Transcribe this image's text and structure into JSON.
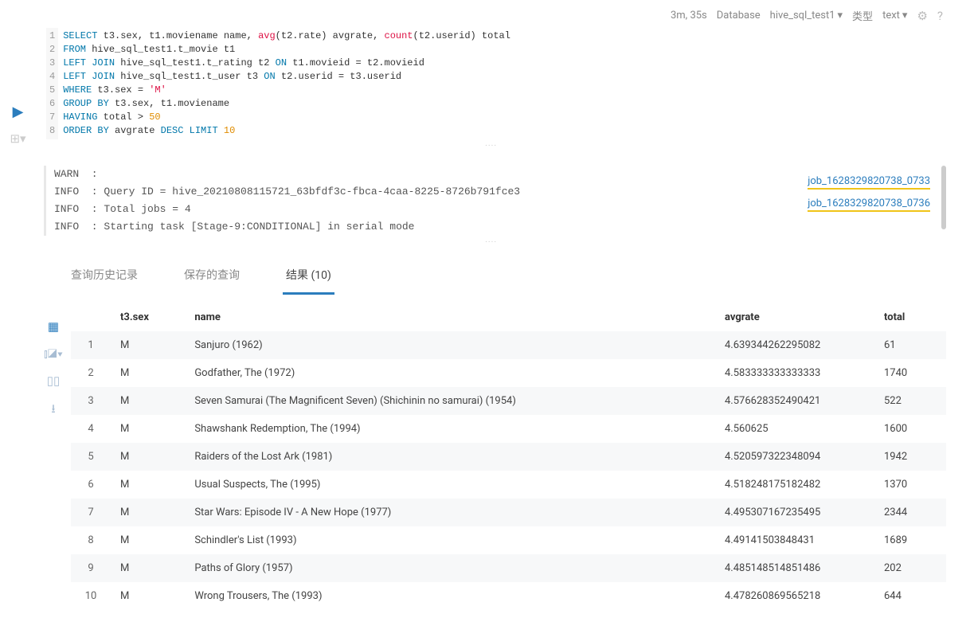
{
  "topbar": {
    "elapsed": "3m, 35s",
    "db_label": "Database",
    "db_value": "hive_sql_test1",
    "type_label": "类型",
    "type_value": "text"
  },
  "sql": {
    "lines": [
      "1",
      "2",
      "3",
      "4",
      "5",
      "6",
      "7",
      "8"
    ]
  },
  "log": {
    "l1": "WARN  :",
    "l2": "INFO  : Query ID = hive_20210808115721_63bfdf3c-fbca-4caa-8225-8726b791fce3",
    "l3": "INFO  : Total jobs = 4",
    "l4": "INFO  : Starting task [Stage-9:CONDITIONAL] in serial mode"
  },
  "jobs": {
    "a": "job_1628329820738_0733",
    "b": "job_1628329820738_0736"
  },
  "tabs": {
    "history": "查询历史记录",
    "saved": "保存的查询",
    "results": "结果 (10)"
  },
  "columns": {
    "c1": "",
    "c2": "t3.sex",
    "c3": "name",
    "c4": "avgrate",
    "c5": "total"
  },
  "rows": [
    {
      "n": "1",
      "sex": "M",
      "name": "Sanjuro (1962)",
      "avg": "4.639344262295082",
      "total": "61"
    },
    {
      "n": "2",
      "sex": "M",
      "name": "Godfather, The (1972)",
      "avg": "4.583333333333333",
      "total": "1740"
    },
    {
      "n": "3",
      "sex": "M",
      "name": "Seven Samurai (The Magnificent Seven) (Shichinin no samurai) (1954)",
      "avg": "4.576628352490421",
      "total": "522"
    },
    {
      "n": "4",
      "sex": "M",
      "name": "Shawshank Redemption, The (1994)",
      "avg": "4.560625",
      "total": "1600"
    },
    {
      "n": "5",
      "sex": "M",
      "name": "Raiders of the Lost Ark (1981)",
      "avg": "4.520597322348094",
      "total": "1942"
    },
    {
      "n": "6",
      "sex": "M",
      "name": "Usual Suspects, The (1995)",
      "avg": "4.518248175182482",
      "total": "1370"
    },
    {
      "n": "7",
      "sex": "M",
      "name": "Star Wars: Episode IV - A New Hope (1977)",
      "avg": "4.495307167235495",
      "total": "2344"
    },
    {
      "n": "8",
      "sex": "M",
      "name": "Schindler's List (1993)",
      "avg": "4.49141503848431",
      "total": "1689"
    },
    {
      "n": "9",
      "sex": "M",
      "name": "Paths of Glory (1957)",
      "avg": "4.485148514851486",
      "total": "202"
    },
    {
      "n": "10",
      "sex": "M",
      "name": "Wrong Trousers, The (1993)",
      "avg": "4.478260869565218",
      "total": "644"
    }
  ]
}
